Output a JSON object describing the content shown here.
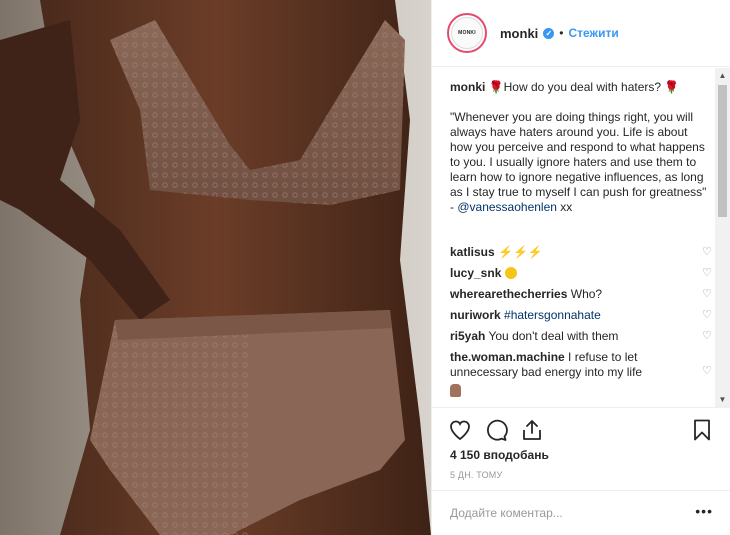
{
  "post": {
    "image_alt": "Woman in brown lace lingerie set"
  },
  "header": {
    "avatar_text": "MONKI",
    "username": "monki",
    "verified_glyph": "✓",
    "separator": "•",
    "follow_label": "Стежити"
  },
  "caption": {
    "username": "monki",
    "rose_glyph": "🌹",
    "headline": "How do you deal with haters?",
    "quote": "\"Whenever you are doing things right, you will always have haters around you. Life is about how you perceive and respond to what happens to you. I usually ignore haters and use them to learn how to ignore negative influences, as long as I stay true to myself I can push for greatness\" - ",
    "mention": "@vanessaohenlen",
    "suffix": " xx"
  },
  "comments": [
    {
      "user": "katlisus",
      "text": "⚡⚡⚡",
      "heart": "♡"
    },
    {
      "user": "lucy_snk",
      "text": "",
      "heart": "♡"
    },
    {
      "user": "wherearethecherries",
      "text": "Who?",
      "heart": "♡"
    },
    {
      "user": "nuriwork",
      "text": "#hatersgonnahate",
      "heart": "♡"
    },
    {
      "user": "ri5yah",
      "text": "You don't deal with them",
      "heart": "♡"
    },
    {
      "user": "the.woman.machine",
      "text": "I refuse to let unnecessary bad energy into my life",
      "heart": "♡"
    }
  ],
  "scrollbar": {
    "up": "▲",
    "down": "▼"
  },
  "actions": {
    "like_icon": "heart-outline",
    "comment_icon": "speech-bubble",
    "share_icon": "share-arrow",
    "save_icon": "bookmark"
  },
  "likes_label": "4 150 вподобань",
  "time_label": "5 ДН. ТОМУ",
  "add_comment": {
    "placeholder": "Додайте коментар...",
    "more_glyph": "•••"
  },
  "colors": {
    "accent": "#3897f0",
    "link": "#003569",
    "border": "#efefef",
    "muted": "#999999"
  }
}
